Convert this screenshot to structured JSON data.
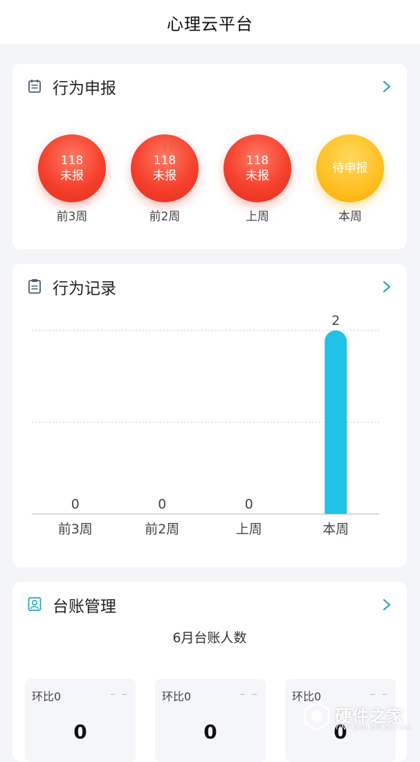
{
  "app": {
    "title": "心理云平台"
  },
  "colors": {
    "accent_blue": "#20c2e8",
    "report_red": "#f5402c",
    "report_yellow": "#ffbf22",
    "chevron": "#38a6c6"
  },
  "report": {
    "title": "行为申报",
    "icon": "calendar-icon",
    "items": [
      {
        "count": "118",
        "status": "未报",
        "period": "前3周",
        "state": "missed"
      },
      {
        "count": "118",
        "status": "未报",
        "period": "前2周",
        "state": "missed"
      },
      {
        "count": "118",
        "status": "未报",
        "period": "上周",
        "state": "missed"
      },
      {
        "count": "",
        "status": "待申报",
        "period": "本周",
        "state": "pending"
      }
    ]
  },
  "record": {
    "title": "行为记录",
    "icon": "clipboard-icon"
  },
  "chart_data": {
    "type": "bar",
    "categories": [
      "前3周",
      "前2周",
      "上周",
      "本周"
    ],
    "values": [
      0,
      0,
      0,
      2
    ],
    "ylim": [
      0,
      2
    ],
    "grid": true,
    "bar_color": "#20c2e8"
  },
  "ledger": {
    "title": "台账管理",
    "icon": "user-card-icon",
    "subtitle": "6月台账人数",
    "stats": [
      {
        "ratio": "环比0",
        "dash": "– –",
        "value": "0"
      },
      {
        "ratio": "环比0",
        "dash": "– –",
        "value": "0"
      },
      {
        "ratio": "环比0",
        "dash": "– –",
        "value": "0"
      }
    ]
  },
  "watermark": {
    "text": "硬件之家",
    "sub": "YING JIAN ZHI JIA.COM"
  }
}
